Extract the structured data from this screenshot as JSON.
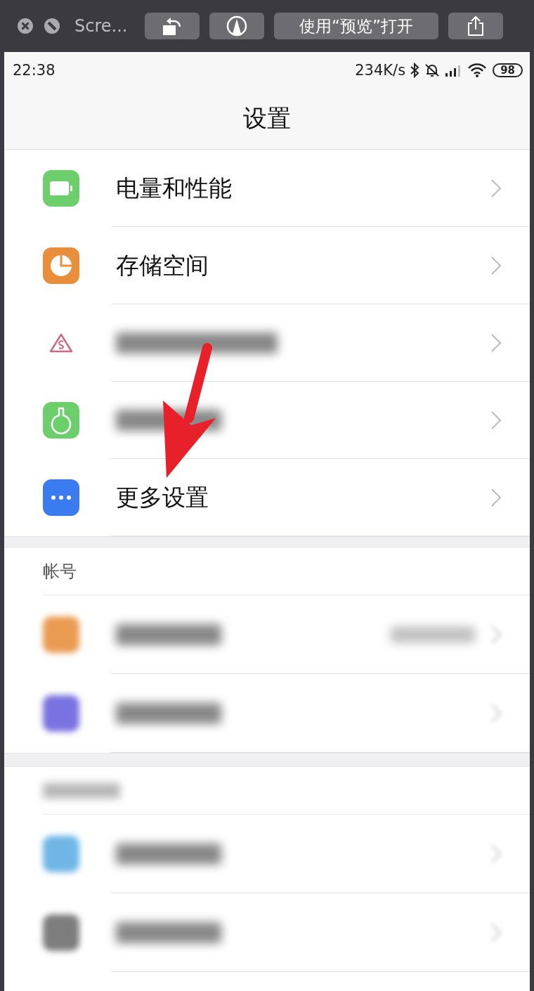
{
  "window": {
    "title": "Scre...",
    "open_button": "使用“预览”打开"
  },
  "status_bar": {
    "time": "22:38",
    "speed": "234K/s",
    "battery": "98"
  },
  "header": {
    "title": "设置"
  },
  "sections": [
    {
      "kind": "plain",
      "items": [
        {
          "kind": "clear",
          "label": "电量和性能",
          "color": "#6ccf6b"
        },
        {
          "kind": "clear",
          "label": "存储空间",
          "color": "#e98f3c"
        },
        {
          "kind": "blurred",
          "color": "#d06a7e"
        },
        {
          "kind": "blurred",
          "color": "#6ccf6b"
        },
        {
          "kind": "clear",
          "label": "更多设置",
          "color": "#3a7cf0"
        }
      ]
    },
    {
      "kind": "titled",
      "title": "帐号",
      "items": [
        {
          "kind": "blurred",
          "color": "#ea9b52",
          "detail": true
        },
        {
          "kind": "blurred",
          "color": "#7a72e0"
        }
      ]
    },
    {
      "kind": "blurred_title",
      "items": [
        {
          "kind": "blurred",
          "color": "#6fb6e6"
        },
        {
          "kind": "blurred",
          "color": "#7d7d7d"
        }
      ]
    }
  ]
}
